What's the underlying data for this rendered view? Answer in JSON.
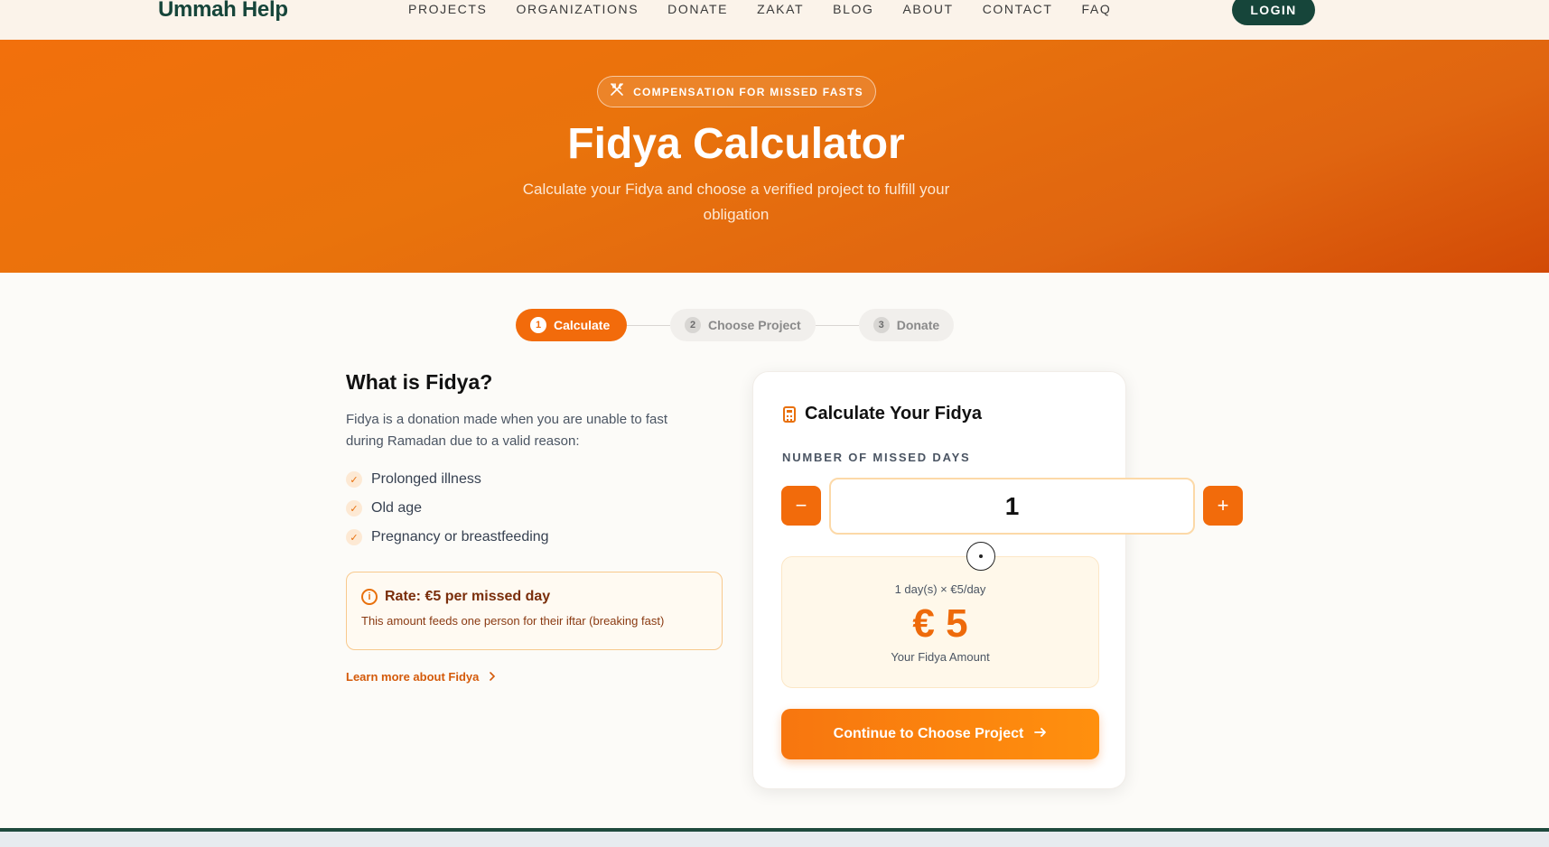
{
  "header": {
    "logo": "Ummah Help",
    "nav": [
      "PROJECTS",
      "ORGANIZATIONS",
      "DONATE",
      "ZAKAT",
      "BLOG",
      "ABOUT",
      "CONTACT",
      "FAQ"
    ],
    "login_label": "LOGIN"
  },
  "hero": {
    "badge": "COMPENSATION FOR MISSED FASTS",
    "badge_icon": "utensils-crossed-icon",
    "title": "Fidya Calculator",
    "subtitle": "Calculate your Fidya and choose a verified project to fulfill your obligation"
  },
  "stepper": {
    "steps": [
      {
        "num": "1",
        "label": "Calculate",
        "active": true
      },
      {
        "num": "2",
        "label": "Choose Project",
        "active": false
      },
      {
        "num": "3",
        "label": "Donate",
        "active": false
      }
    ]
  },
  "info": {
    "title": "What is Fidya?",
    "description": "Fidya is a donation made when you are unable to fast during Ramadan due to a valid reason:",
    "reasons": [
      "Prolonged illness",
      "Old age",
      "Pregnancy or breastfeeding"
    ],
    "rate_title": "Rate: €5 per missed day",
    "rate_sub": "This amount feeds one person for their iftar (breaking fast)",
    "learn_more": "Learn more about Fidya"
  },
  "calculator": {
    "title": "Calculate Your Fidya",
    "days_label": "NUMBER OF MISSED DAYS",
    "minus_label": "−",
    "plus_label": "+",
    "days_value": "1",
    "formula": "1 day(s) × €5/day",
    "amount": "€ 5",
    "amount_label": "Your Fidya Amount",
    "continue_label": "Continue to Choose Project"
  },
  "colors": {
    "brand_green": "#16453a",
    "accent_orange": "#f26b0b"
  }
}
